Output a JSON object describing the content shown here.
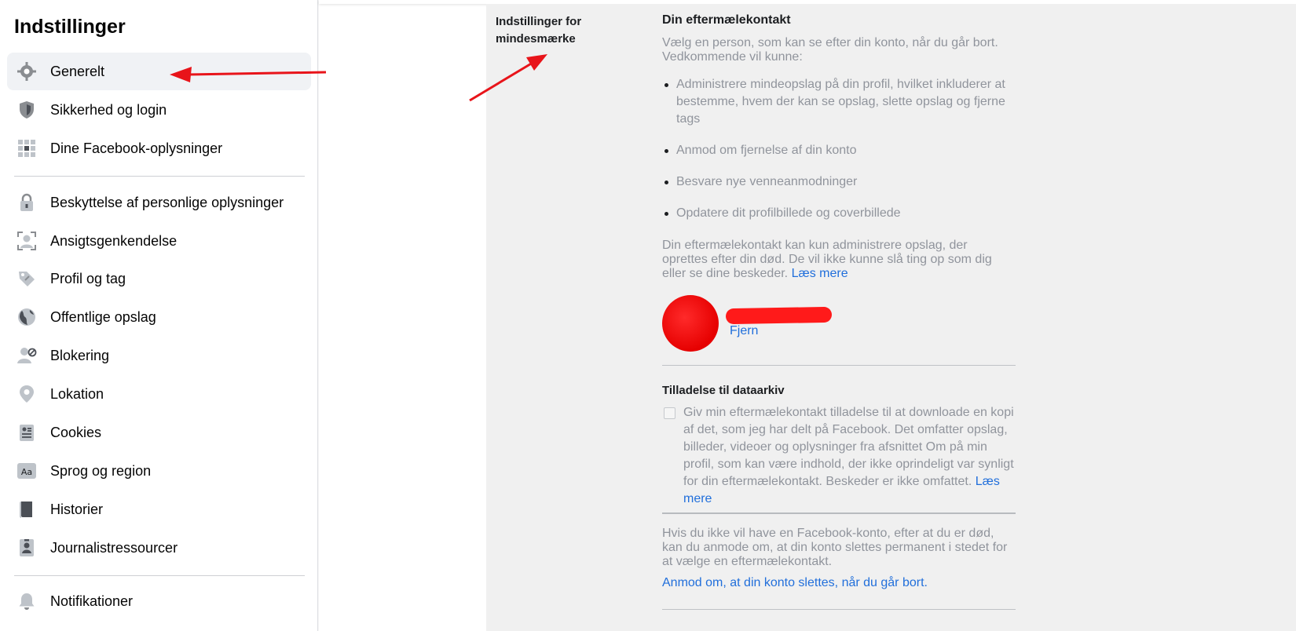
{
  "sidebar": {
    "title": "Indstillinger",
    "items": [
      {
        "label": "Generelt",
        "icon": "gear-icon"
      },
      {
        "label": "Sikkerhed og login",
        "icon": "shield-icon"
      },
      {
        "label": "Dine Facebook-oplysninger",
        "icon": "grid-icon"
      },
      {
        "label": "Beskyttelse af personlige oplysninger",
        "icon": "lock-icon"
      },
      {
        "label": "Ansigtsgenkendelse",
        "icon": "face-scan-icon"
      },
      {
        "label": "Profil og tag",
        "icon": "tag-icon"
      },
      {
        "label": "Offentlige opslag",
        "icon": "globe-icon"
      },
      {
        "label": "Blokering",
        "icon": "block-user-icon"
      },
      {
        "label": "Lokation",
        "icon": "location-pin-icon"
      },
      {
        "label": "Cookies",
        "icon": "cookie-doc-icon"
      },
      {
        "label": "Sprog og region",
        "icon": "language-icon"
      },
      {
        "label": "Historier",
        "icon": "book-icon"
      },
      {
        "label": "Journalistressourcer",
        "icon": "id-card-icon"
      },
      {
        "label": "Notifikationer",
        "icon": "bell-icon"
      }
    ],
    "active_index": 0
  },
  "main": {
    "section_label": "Indstillinger for mindesmærke",
    "legacy_heading": "Din eftermælekontakt",
    "legacy_intro": "Vælg en person, som kan se efter din konto, når du går bort. Vedkommende vil kunne:",
    "abilities": [
      "Administrere mindeopslag på din profil, hvilket inkluderer at bestemme, hvem der kan se opslag, slette opslag og fjerne tags",
      "Anmod om fjernelse af din konto",
      "Besvare nye venneanmodninger",
      "Opdatere dit profilbillede og coverbillede"
    ],
    "legacy_note": "Din eftermælekontakt kan kun administrere opslag, der oprettes efter din død. De vil ikke kunne slå ting op som dig eller se dine beskeder.",
    "learn_more": "Læs mere",
    "remove_label": "Fjern",
    "archive_heading": "Tilladelse til dataarkiv",
    "archive_text": "Giv min eftermælekontakt tilladelse til at downloade en kopi af det, som jeg har delt på Facebook. Det omfatter opslag, billeder, videoer og oplysninger fra afsnittet Om på min profil, som kan være indhold, der ikke oprindeligt var synligt for din eftermælekontakt. Beskeder er ikke omfattet.",
    "archive_learn_more": "Læs mere",
    "delete_text": "Hvis du ikke vil have en Facebook-konto, efter at du er død, kan du anmode om, at din konto slettes permanent i stedet for at vælge en eftermælekontakt.",
    "delete_link": "Anmod om, at din konto slettes, når du går bort."
  },
  "colors": {
    "link": "#216fdb",
    "muted_text": "#90949c",
    "annotation": "#e8141a",
    "active_bg": "#f0f2f5"
  }
}
